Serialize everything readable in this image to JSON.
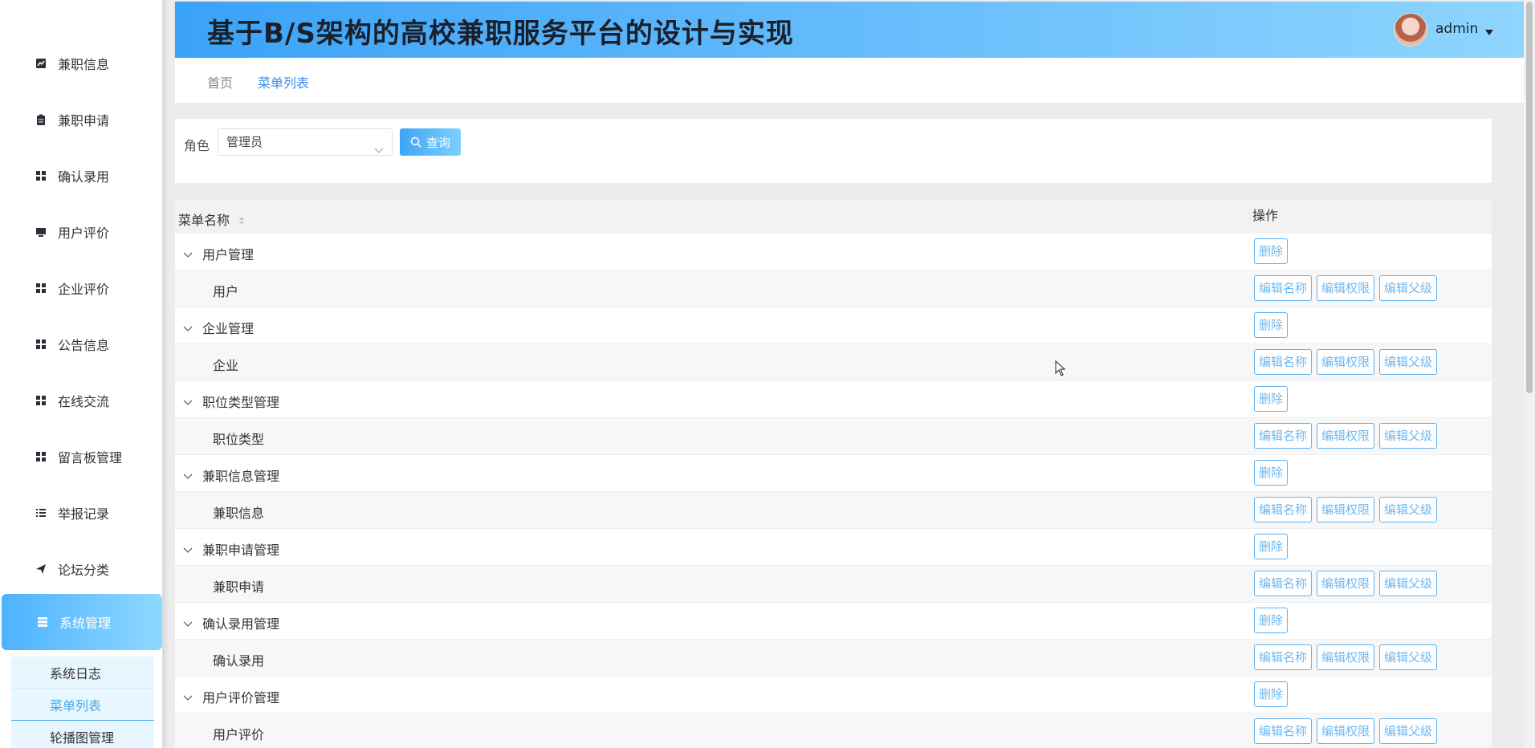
{
  "header": {
    "title": "基于B/S架构的高校兼职服务平台的设计与实现",
    "user": "admin"
  },
  "sidebar": {
    "items": [
      {
        "label": "兼职信息",
        "icon": "chart-icon"
      },
      {
        "label": "兼职申请",
        "icon": "clipboard-icon"
      },
      {
        "label": "确认录用",
        "icon": "grid-icon"
      },
      {
        "label": "用户评价",
        "icon": "monitor-icon"
      },
      {
        "label": "企业评价",
        "icon": "grid-icon"
      },
      {
        "label": "公告信息",
        "icon": "grid-icon"
      },
      {
        "label": "在线交流",
        "icon": "grid-icon"
      },
      {
        "label": "留言板管理",
        "icon": "grid-icon"
      },
      {
        "label": "举报记录",
        "icon": "list-icon"
      },
      {
        "label": "论坛分类",
        "icon": "send-icon"
      },
      {
        "label": "系统管理",
        "icon": "stack-icon",
        "active": true
      }
    ],
    "submenu": [
      "系统日志",
      "菜单列表",
      "轮播图管理"
    ]
  },
  "breadcrumb": {
    "home": "首页",
    "current": "菜单列表"
  },
  "search": {
    "role_label": "角色",
    "role_value": "管理员",
    "query_label": "查询"
  },
  "table": {
    "headers": {
      "name": "菜单名称",
      "ops": "操作"
    },
    "rows": [
      {
        "type": "parent",
        "label": "用户管理"
      },
      {
        "type": "child",
        "label": "用户"
      },
      {
        "type": "parent",
        "label": "企业管理"
      },
      {
        "type": "child",
        "label": "企业"
      },
      {
        "type": "parent",
        "label": "职位类型管理"
      },
      {
        "type": "child",
        "label": "职位类型"
      },
      {
        "type": "parent",
        "label": "兼职信息管理"
      },
      {
        "type": "child",
        "label": "兼职信息"
      },
      {
        "type": "parent",
        "label": "兼职申请管理"
      },
      {
        "type": "child",
        "label": "兼职申请"
      },
      {
        "type": "parent",
        "label": "确认录用管理"
      },
      {
        "type": "child",
        "label": "确认录用"
      },
      {
        "type": "parent",
        "label": "用户评价管理"
      },
      {
        "type": "child",
        "label": "用户评价"
      }
    ],
    "buttons": {
      "delete": "删除",
      "edit_name": "编辑名称",
      "edit_perm": "编辑权限",
      "edit_parent": "编辑父级"
    }
  },
  "colors": {
    "accent": "#4db2ff",
    "button_text": "#6fb8ef"
  }
}
